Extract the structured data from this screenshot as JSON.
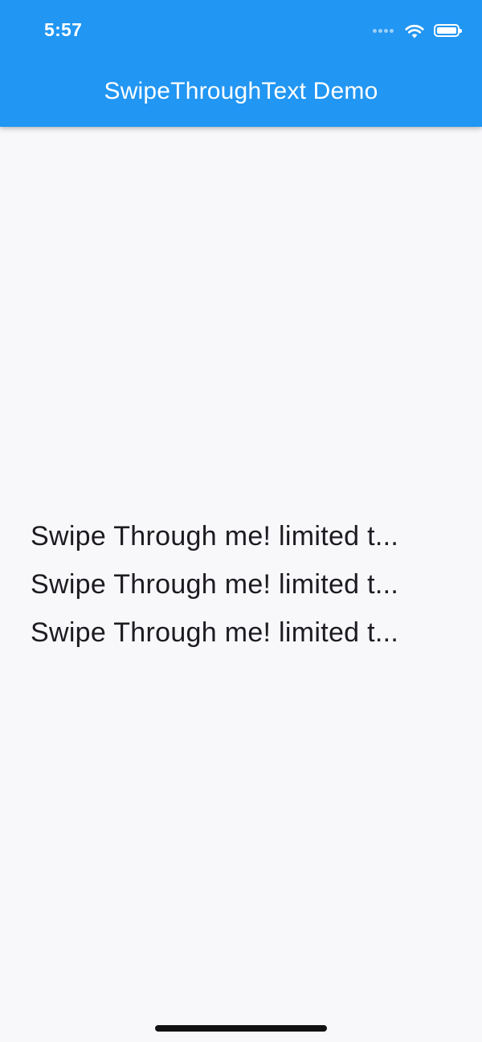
{
  "status_bar": {
    "time": "5:57"
  },
  "app_bar": {
    "title": "SwipeThroughText Demo",
    "color": "#2196f3"
  },
  "content": {
    "background": "#f8f7fa",
    "items": [
      {
        "text": "Swipe Through me! limited t..."
      },
      {
        "text": "Swipe Through me! limited t..."
      },
      {
        "text": "Swipe Through me! limited t..."
      }
    ]
  },
  "icons": {
    "cellular": "cellular-signal-icon",
    "wifi": "wifi-icon",
    "battery": "battery-icon"
  }
}
